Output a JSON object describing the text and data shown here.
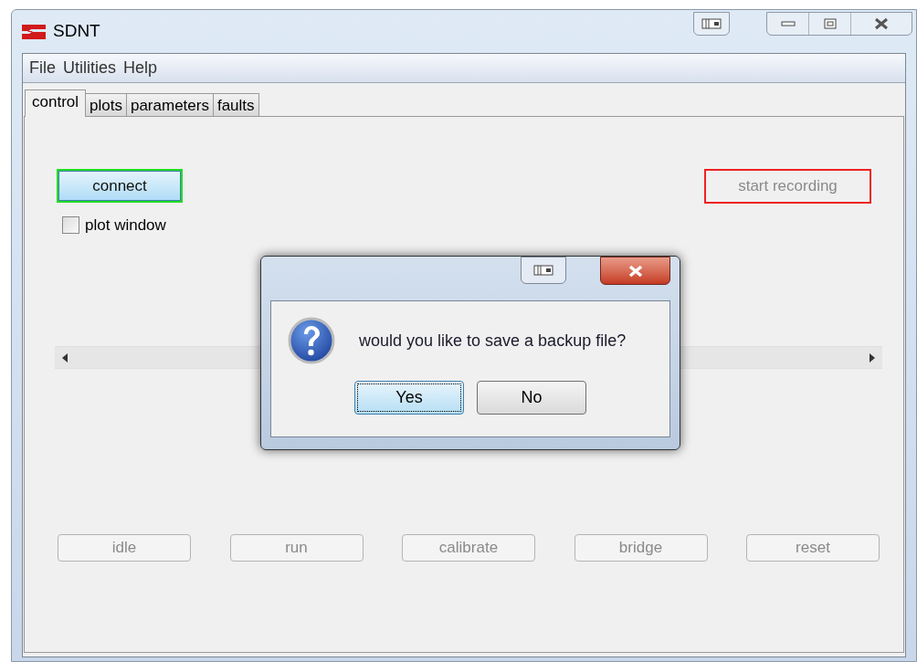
{
  "window": {
    "title": "SDNT"
  },
  "menu": [
    "File",
    "Utilities",
    "Help"
  ],
  "tabs": [
    {
      "label": "control",
      "selected": true
    },
    {
      "label": "plots",
      "selected": false
    },
    {
      "label": "parameters",
      "selected": false
    },
    {
      "label": "faults",
      "selected": false
    }
  ],
  "connect_button": {
    "label": "connect",
    "disabled": false,
    "color": "#22dd22"
  },
  "record_button": {
    "label": "start recording",
    "disabled": true,
    "color": "#ee2222"
  },
  "plot_window_checkbox": {
    "label": "plot window",
    "checked": false
  },
  "mode_buttons": [
    {
      "label": "idle",
      "disabled": true
    },
    {
      "label": "run",
      "disabled": true
    },
    {
      "label": "calibrate",
      "disabled": true
    },
    {
      "label": "bridge",
      "disabled": true
    },
    {
      "label": "reset",
      "disabled": true
    }
  ],
  "dialog": {
    "message": "would you like to save a backup file?",
    "buttons": [
      {
        "label": "Yes",
        "focused": true
      },
      {
        "label": "No",
        "focused": false
      }
    ]
  }
}
